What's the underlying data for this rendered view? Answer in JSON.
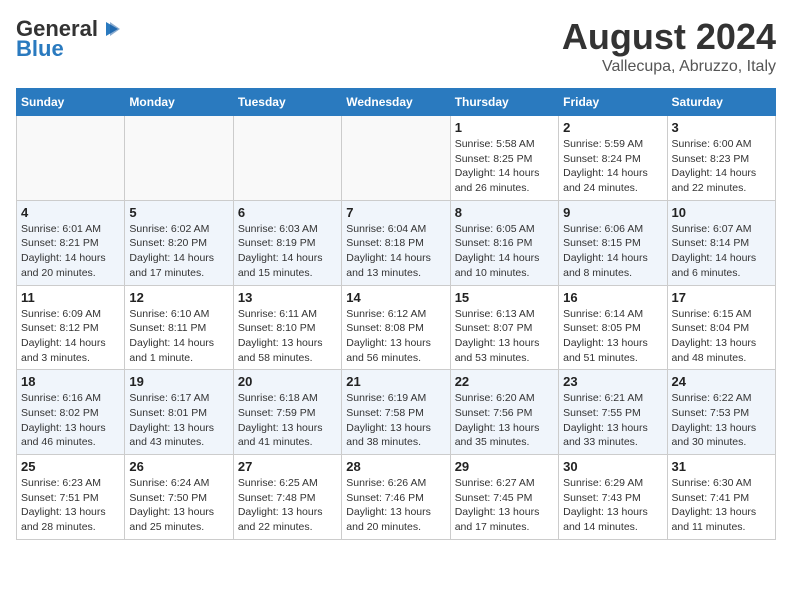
{
  "header": {
    "logo_general": "General",
    "logo_blue": "Blue",
    "month": "August 2024",
    "location": "Vallecupa, Abruzzo, Italy"
  },
  "days_of_week": [
    "Sunday",
    "Monday",
    "Tuesday",
    "Wednesday",
    "Thursday",
    "Friday",
    "Saturday"
  ],
  "weeks": [
    [
      {
        "day": "",
        "info": ""
      },
      {
        "day": "",
        "info": ""
      },
      {
        "day": "",
        "info": ""
      },
      {
        "day": "",
        "info": ""
      },
      {
        "day": "1",
        "info": "Sunrise: 5:58 AM\nSunset: 8:25 PM\nDaylight: 14 hours and 26 minutes."
      },
      {
        "day": "2",
        "info": "Sunrise: 5:59 AM\nSunset: 8:24 PM\nDaylight: 14 hours and 24 minutes."
      },
      {
        "day": "3",
        "info": "Sunrise: 6:00 AM\nSunset: 8:23 PM\nDaylight: 14 hours and 22 minutes."
      }
    ],
    [
      {
        "day": "4",
        "info": "Sunrise: 6:01 AM\nSunset: 8:21 PM\nDaylight: 14 hours and 20 minutes."
      },
      {
        "day": "5",
        "info": "Sunrise: 6:02 AM\nSunset: 8:20 PM\nDaylight: 14 hours and 17 minutes."
      },
      {
        "day": "6",
        "info": "Sunrise: 6:03 AM\nSunset: 8:19 PM\nDaylight: 14 hours and 15 minutes."
      },
      {
        "day": "7",
        "info": "Sunrise: 6:04 AM\nSunset: 8:18 PM\nDaylight: 14 hours and 13 minutes."
      },
      {
        "day": "8",
        "info": "Sunrise: 6:05 AM\nSunset: 8:16 PM\nDaylight: 14 hours and 10 minutes."
      },
      {
        "day": "9",
        "info": "Sunrise: 6:06 AM\nSunset: 8:15 PM\nDaylight: 14 hours and 8 minutes."
      },
      {
        "day": "10",
        "info": "Sunrise: 6:07 AM\nSunset: 8:14 PM\nDaylight: 14 hours and 6 minutes."
      }
    ],
    [
      {
        "day": "11",
        "info": "Sunrise: 6:09 AM\nSunset: 8:12 PM\nDaylight: 14 hours and 3 minutes."
      },
      {
        "day": "12",
        "info": "Sunrise: 6:10 AM\nSunset: 8:11 PM\nDaylight: 14 hours and 1 minute."
      },
      {
        "day": "13",
        "info": "Sunrise: 6:11 AM\nSunset: 8:10 PM\nDaylight: 13 hours and 58 minutes."
      },
      {
        "day": "14",
        "info": "Sunrise: 6:12 AM\nSunset: 8:08 PM\nDaylight: 13 hours and 56 minutes."
      },
      {
        "day": "15",
        "info": "Sunrise: 6:13 AM\nSunset: 8:07 PM\nDaylight: 13 hours and 53 minutes."
      },
      {
        "day": "16",
        "info": "Sunrise: 6:14 AM\nSunset: 8:05 PM\nDaylight: 13 hours and 51 minutes."
      },
      {
        "day": "17",
        "info": "Sunrise: 6:15 AM\nSunset: 8:04 PM\nDaylight: 13 hours and 48 minutes."
      }
    ],
    [
      {
        "day": "18",
        "info": "Sunrise: 6:16 AM\nSunset: 8:02 PM\nDaylight: 13 hours and 46 minutes."
      },
      {
        "day": "19",
        "info": "Sunrise: 6:17 AM\nSunset: 8:01 PM\nDaylight: 13 hours and 43 minutes."
      },
      {
        "day": "20",
        "info": "Sunrise: 6:18 AM\nSunset: 7:59 PM\nDaylight: 13 hours and 41 minutes."
      },
      {
        "day": "21",
        "info": "Sunrise: 6:19 AM\nSunset: 7:58 PM\nDaylight: 13 hours and 38 minutes."
      },
      {
        "day": "22",
        "info": "Sunrise: 6:20 AM\nSunset: 7:56 PM\nDaylight: 13 hours and 35 minutes."
      },
      {
        "day": "23",
        "info": "Sunrise: 6:21 AM\nSunset: 7:55 PM\nDaylight: 13 hours and 33 minutes."
      },
      {
        "day": "24",
        "info": "Sunrise: 6:22 AM\nSunset: 7:53 PM\nDaylight: 13 hours and 30 minutes."
      }
    ],
    [
      {
        "day": "25",
        "info": "Sunrise: 6:23 AM\nSunset: 7:51 PM\nDaylight: 13 hours and 28 minutes."
      },
      {
        "day": "26",
        "info": "Sunrise: 6:24 AM\nSunset: 7:50 PM\nDaylight: 13 hours and 25 minutes."
      },
      {
        "day": "27",
        "info": "Sunrise: 6:25 AM\nSunset: 7:48 PM\nDaylight: 13 hours and 22 minutes."
      },
      {
        "day": "28",
        "info": "Sunrise: 6:26 AM\nSunset: 7:46 PM\nDaylight: 13 hours and 20 minutes."
      },
      {
        "day": "29",
        "info": "Sunrise: 6:27 AM\nSunset: 7:45 PM\nDaylight: 13 hours and 17 minutes."
      },
      {
        "day": "30",
        "info": "Sunrise: 6:29 AM\nSunset: 7:43 PM\nDaylight: 13 hours and 14 minutes."
      },
      {
        "day": "31",
        "info": "Sunrise: 6:30 AM\nSunset: 7:41 PM\nDaylight: 13 hours and 11 minutes."
      }
    ]
  ]
}
